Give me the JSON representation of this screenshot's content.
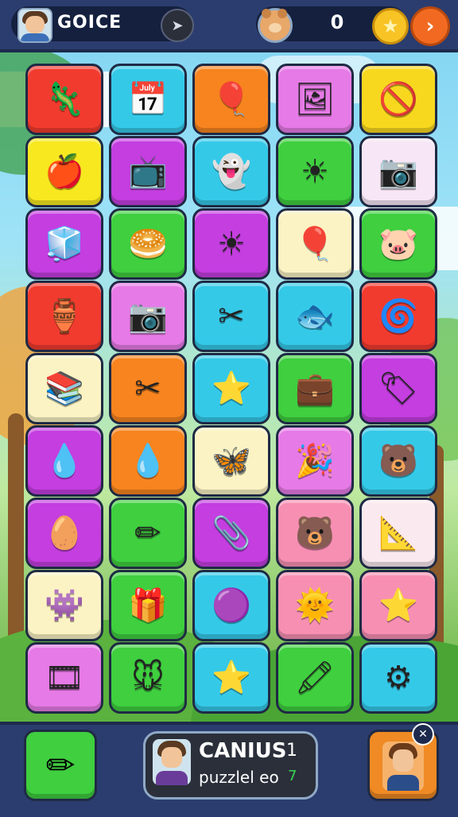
{
  "header": {
    "username": "GOICE",
    "play_icon": "play-arrow-icon",
    "opponent_avatar_icon": "bear-face-icon",
    "score": "0",
    "coin_icon": "star-coin-icon",
    "next_icon": "chevron-right-icon"
  },
  "board": {
    "columns": 5,
    "rows": 9,
    "tiles": [
      {
        "icon": "🦎",
        "name": "green-creature-icon",
        "color": "#f23b2f"
      },
      {
        "icon": "📅",
        "name": "calendar-icon",
        "color": "#35c9e8"
      },
      {
        "icon": "🎈",
        "name": "balloon-icon",
        "color": "#f7841f"
      },
      {
        "icon": "🖼",
        "name": "picture-card-icon",
        "color": "#e67ae6"
      },
      {
        "icon": "🚫",
        "name": "striped-card-icon",
        "color": "#f7d81f"
      },
      {
        "icon": "🍎",
        "name": "apple-icon",
        "color": "#f7e81f"
      },
      {
        "icon": "📺",
        "name": "tv-icon",
        "color": "#c43ee0"
      },
      {
        "icon": "👻",
        "name": "ghost-icon",
        "color": "#35c9e8"
      },
      {
        "icon": "☀",
        "name": "sun-icon",
        "color": "#3fcf3f"
      },
      {
        "icon": "📷",
        "name": "camera-icon",
        "color": "#f7e6f5"
      },
      {
        "icon": "🧊",
        "name": "box-icon",
        "color": "#c43ee0"
      },
      {
        "icon": "🥯",
        "name": "dome-icon",
        "color": "#3fcf3f"
      },
      {
        "icon": "☀",
        "name": "sun-icon",
        "color": "#c43ee0"
      },
      {
        "icon": "🎈",
        "name": "balloon-stand-icon",
        "color": "#fbf3c4"
      },
      {
        "icon": "🐷",
        "name": "face-bubble-icon",
        "color": "#3fcf3f"
      },
      {
        "icon": "🏺",
        "name": "vase-icon",
        "color": "#f23b2f"
      },
      {
        "icon": "📷",
        "name": "camera-icon",
        "color": "#e67ae6"
      },
      {
        "icon": "✂",
        "name": "scissors-icon",
        "color": "#35c9e8"
      },
      {
        "icon": "🐟",
        "name": "fish-icon",
        "color": "#35c9e8"
      },
      {
        "icon": "🌀",
        "name": "pinwheel-icon",
        "color": "#f23b2f"
      },
      {
        "icon": "📚",
        "name": "books-icon",
        "color": "#fbf3c4"
      },
      {
        "icon": "✂",
        "name": "scissors-icon",
        "color": "#f7841f"
      },
      {
        "icon": "⭐",
        "name": "star-icon",
        "color": "#35c9e8"
      },
      {
        "icon": "💼",
        "name": "briefcase-icon",
        "color": "#3fcf3f"
      },
      {
        "icon": "🏷",
        "name": "tag-icon",
        "color": "#c43ee0"
      },
      {
        "icon": "💧",
        "name": "droplet-icon",
        "color": "#c43ee0"
      },
      {
        "icon": "💧",
        "name": "droplet-icon",
        "color": "#f7841f"
      },
      {
        "icon": "🦋",
        "name": "butterfly-icon",
        "color": "#fbf3c4"
      },
      {
        "icon": "🎉",
        "name": "party-hat-icon",
        "color": "#e67ae6"
      },
      {
        "icon": "🐻",
        "name": "bear-face-icon",
        "color": "#35c9e8"
      },
      {
        "icon": "🥚",
        "name": "egg-icon",
        "color": "#c43ee0"
      },
      {
        "icon": "✏",
        "name": "pencil-icon",
        "color": "#3fcf3f"
      },
      {
        "icon": "📎",
        "name": "paperclip-icon",
        "color": "#c43ee0"
      },
      {
        "icon": "🐻",
        "name": "black-bear-icon",
        "color": "#f78fb3"
      },
      {
        "icon": "📐",
        "name": "triangle-icon",
        "color": "#fbe9f0"
      },
      {
        "icon": "👾",
        "name": "monster-icon",
        "color": "#fbf3c4"
      },
      {
        "icon": "🎁",
        "name": "gift-box-icon",
        "color": "#3fcf3f"
      },
      {
        "icon": "🟣",
        "name": "purple-ball-icon",
        "color": "#35c9e8"
      },
      {
        "icon": "🌞",
        "name": "sun-face-icon",
        "color": "#f78fb3"
      },
      {
        "icon": "⭐",
        "name": "star-icon",
        "color": "#f78fb3"
      },
      {
        "icon": "🎞",
        "name": "film-icon",
        "color": "#e67ae6"
      },
      {
        "icon": "🐭",
        "name": "mouse-icon",
        "color": "#3fcf3f"
      },
      {
        "icon": "⭐",
        "name": "star-icon",
        "color": "#35c9e8"
      },
      {
        "icon": "🖍",
        "name": "crayon-icon",
        "color": "#3fcf3f"
      },
      {
        "icon": "⚙",
        "name": "gear-icon",
        "color": "#35c9e8"
      }
    ]
  },
  "footer": {
    "tool_icon": "crossed-pencils-icon",
    "card_title": "CANIUS",
    "card_level": "1",
    "card_sub": "puzzlel eo",
    "card_count": "7",
    "friend_icon": "friend-avatar-icon",
    "close_icon": "close-icon",
    "close_glyph": "✕"
  }
}
